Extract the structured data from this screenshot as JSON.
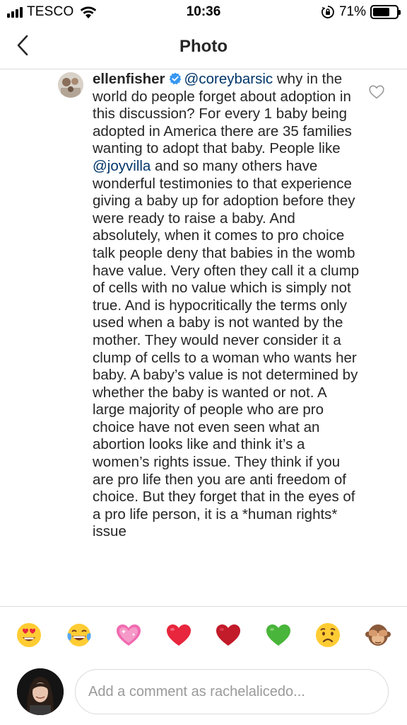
{
  "status_bar": {
    "carrier": "TESCO",
    "time": "10:36",
    "battery_percent": "71%",
    "battery_level": 0.71,
    "signal_bars": 4
  },
  "nav": {
    "title": "Photo",
    "back_icon": "chevron-left-icon"
  },
  "comment": {
    "username": "ellenfisher",
    "verified": true,
    "mention_1": "@coreybarsic",
    "text_1": " why in the world do people forget about adoption in this discussion? For every 1 baby being adopted in America there are 35 families wanting to adopt that baby. People like ",
    "mention_2": "@joyvilla",
    "text_2": " and so many others have wonderful testimonies to that experience giving a baby up for adoption before they were ready to raise a baby. And absolutely, when it comes to pro choice talk people deny that babies in the womb have value. Very often they call it a clump of cells with no value which is simply not true. And is hypocritically the terms only used when a baby is not wanted by the mother. They would never consider it a clump of cells to a woman who wants her baby. A baby’s value is not determined by whether the baby is wanted or not. A large majority of people who are pro choice have not even seen what an abortion looks like and think it’s a women’s rights issue. They think if you are pro life then you are anti freedom of choice. But they forget that in the eyes of a pro life person, it is a *human rights* issue",
    "like_icon": "heart-outline-icon"
  },
  "emoji_bar": [
    {
      "name": "heart-eyes-emoji-icon"
    },
    {
      "name": "tears-of-joy-emoji-icon"
    },
    {
      "name": "sparkling-heart-emoji-icon"
    },
    {
      "name": "red-heart-emoji-icon"
    },
    {
      "name": "dark-red-heart-emoji-icon"
    },
    {
      "name": "green-heart-emoji-icon"
    },
    {
      "name": "worried-face-emoji-icon"
    },
    {
      "name": "see-no-evil-monkey-emoji-icon"
    }
  ],
  "composer": {
    "placeholder": "Add a comment as rachelalicedo..."
  },
  "colors": {
    "mention": "#003569",
    "verified": "#3897f0",
    "divider": "#dbdbdb",
    "text": "#262626",
    "placeholder": "#9a9a9a"
  }
}
